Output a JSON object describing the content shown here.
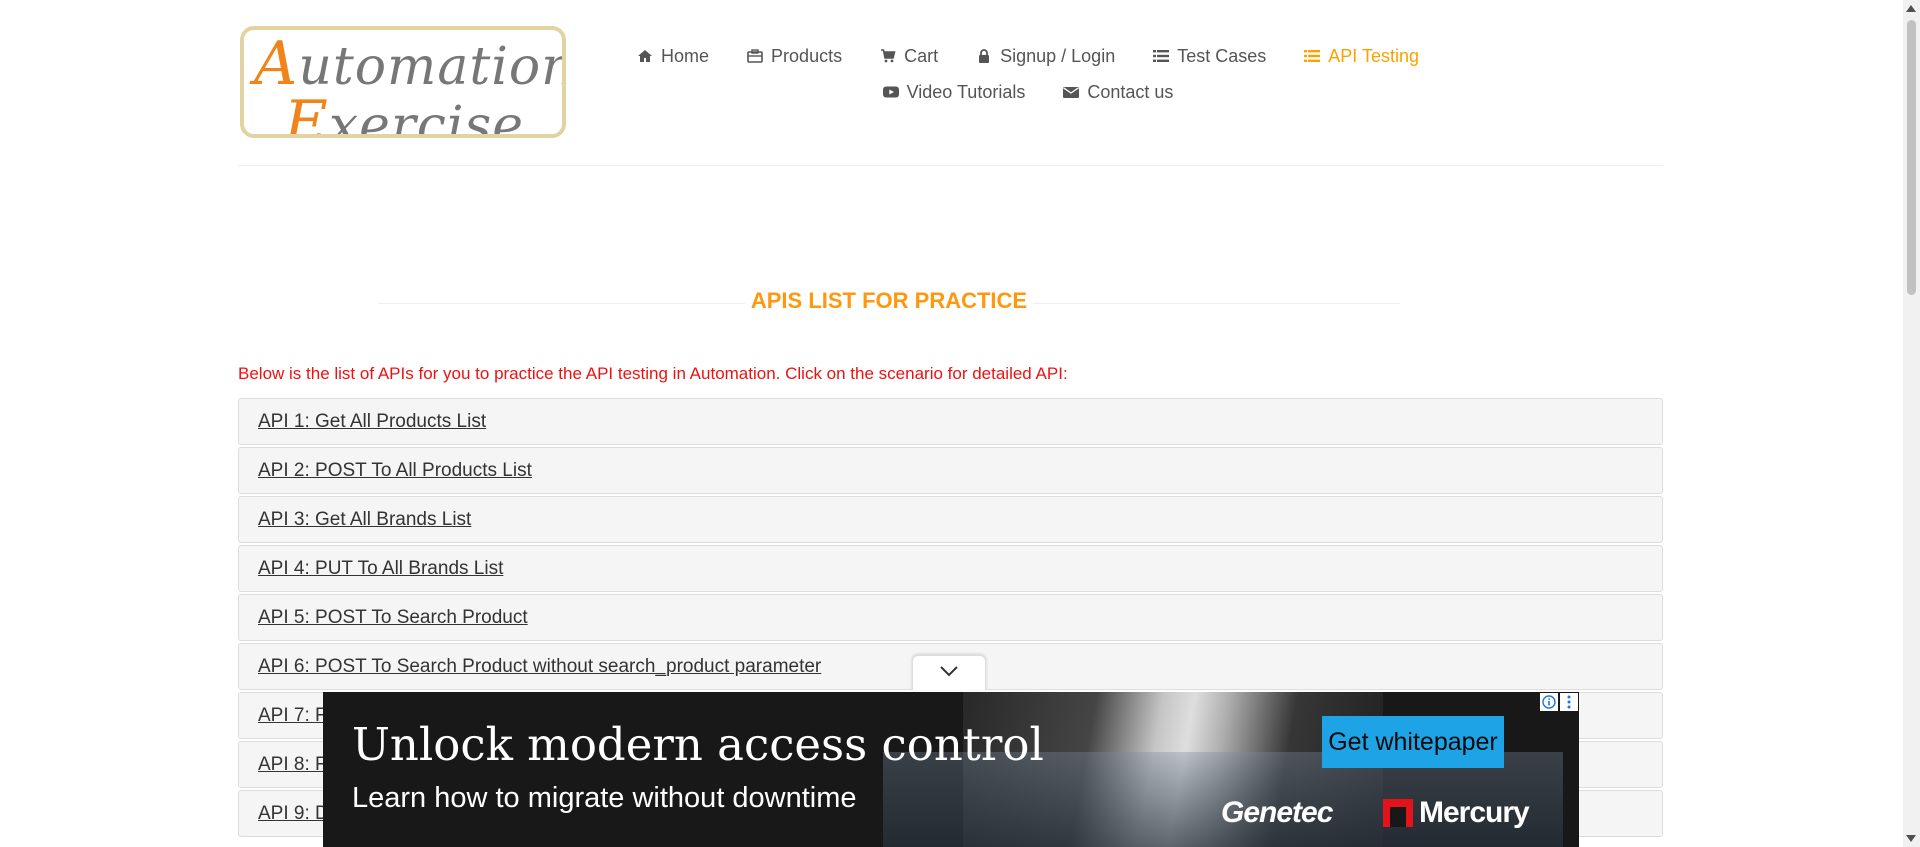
{
  "logo": {
    "line1_first": "A",
    "line1_rest": "utomation",
    "line2_first": "E",
    "line2_rest": "xercise"
  },
  "nav": {
    "row1": [
      {
        "label": "Home",
        "icon": "home-icon"
      },
      {
        "label": "Products",
        "icon": "briefcase-icon"
      },
      {
        "label": "Cart",
        "icon": "cart-icon"
      },
      {
        "label": "Signup / Login",
        "icon": "lock-icon"
      },
      {
        "label": "Test Cases",
        "icon": "list-icon"
      },
      {
        "label": "API Testing",
        "icon": "list-icon",
        "active": true
      }
    ],
    "row2": [
      {
        "label": "Video Tutorials",
        "icon": "youtube-icon"
      },
      {
        "label": "Contact us",
        "icon": "envelope-icon"
      }
    ]
  },
  "main": {
    "title": "APIS LIST FOR PRACTICE",
    "intro": "Below is the list of APIs for you to practice the API testing in Automation. Click on the scenario for detailed API:",
    "apis": [
      "API 1: Get All Products List",
      "API 2: POST To All Products List",
      "API 3: Get All Brands List",
      "API 4: PUT To All Brands List",
      "API 5: POST To Search Product",
      "API 6: POST To Search Product without search_product parameter",
      "API 7: F",
      "API 8: F",
      "API 9: D"
    ]
  },
  "ad": {
    "headline": "Unlock modern access control",
    "subline": "Learn how to migrate without downtime",
    "cta": "Get whitepaper",
    "brand1": "Genetec",
    "brand2": "Mercury",
    "info_icon": "info-icon",
    "more_icon": "more-vertical-icon"
  },
  "colors": {
    "accent": "#fe980f",
    "intro_text": "#ee1111",
    "ad_cta": "#1ea3e6",
    "ad_brand_red": "#e3131b"
  }
}
